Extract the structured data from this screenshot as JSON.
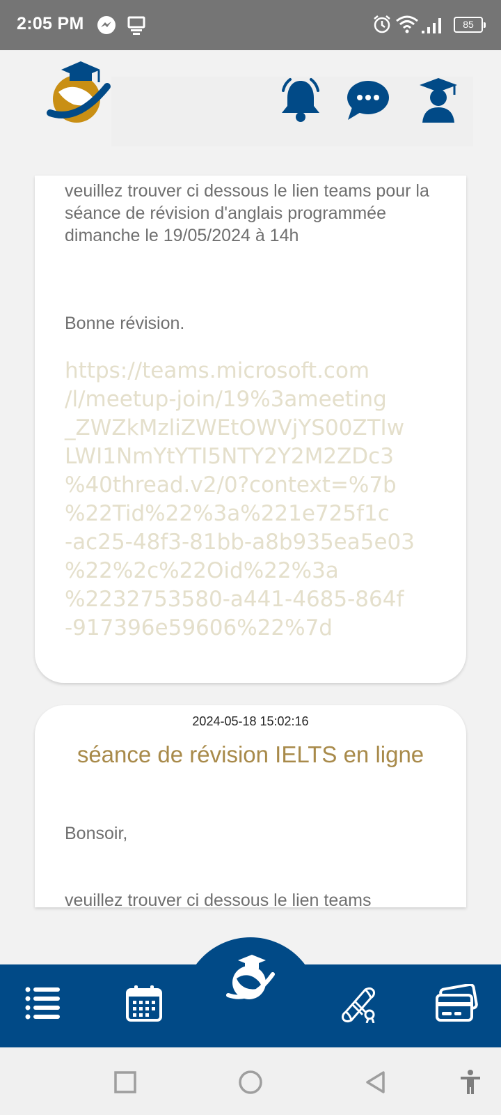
{
  "status_bar": {
    "time": "2:05 PM",
    "icons": [
      "messenger-icon",
      "cast-icon",
      "alarm-icon",
      "wifi-icon",
      "signal-icon"
    ],
    "battery": "85"
  },
  "header": {
    "logo": "graduation-globe-logo",
    "buttons": [
      "bell-icon",
      "chat-bubble-icon",
      "student-profile-icon"
    ]
  },
  "messages": [
    {
      "body": "veuillez trouver ci dessous le lien teams pour la séance de révision d'anglais programmée dimanche le 19/05/2024 à 14h",
      "closing": "Bonne révision.",
      "link_lines": [
        "https://teams.microsoft.com",
        "/l/meetup-join/19%3ameeting",
        "_ZWZkMzliZWEtOWVjYS00ZTIw",
        "LWI1NmYtYTI5NTY2Y2M2ZDc3",
        "%40thread.v2/0?context=%7b",
        "%22Tid%22%3a%221e725f1c",
        "-ac25-48f3-81bb-a8b935ea5e03",
        "%22%2c%22Oid%22%3a",
        "%2232753580-a441-4685-864f",
        "-917396e59606%22%7d"
      ]
    },
    {
      "date": "2024-05-18 15:02:16",
      "title": "séance de révision IELTS en ligne",
      "greeting": "Bonsoir,",
      "body_start": "veuillez trouver ci dessous le lien teams"
    }
  ],
  "bottom_nav": [
    "menu-list-icon",
    "calendar-icon",
    "home-logo-icon",
    "diploma-icon",
    "payment-card-icon"
  ],
  "system_nav": [
    "recents-square-icon",
    "home-circle-icon",
    "back-triangle-icon",
    "accessibility-icon"
  ],
  "colors": {
    "primary": "#014a87",
    "gold": "#a88a4a",
    "link": "#e4dfcb",
    "status_bar": "#757575"
  }
}
